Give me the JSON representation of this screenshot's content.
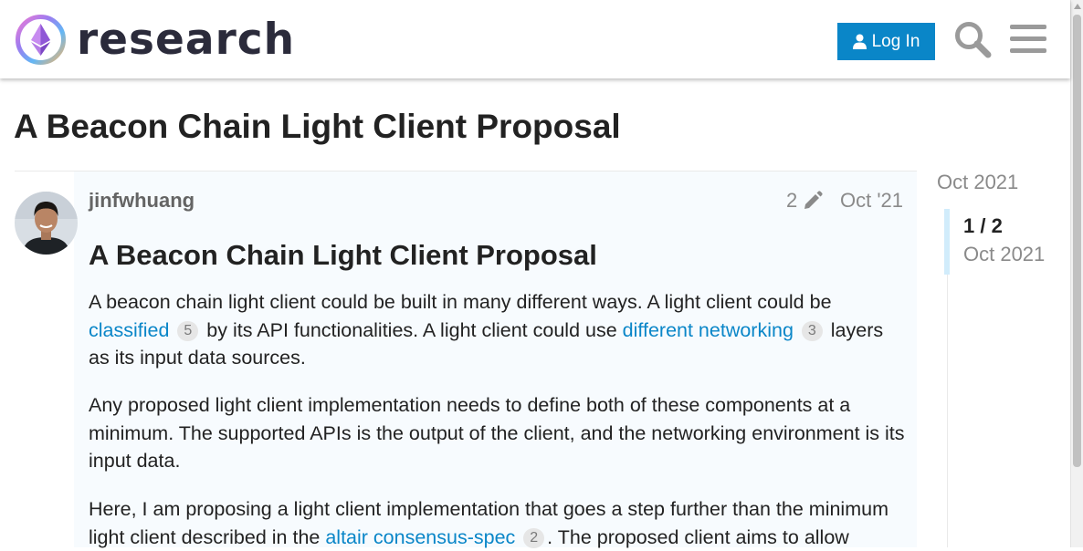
{
  "header": {
    "site_name": "research",
    "login_label": "Log In"
  },
  "colors": {
    "accent": "#0a86c8",
    "badge_bg": "#e6e6e6",
    "post_bg": "#f7fbfe",
    "timeline_handle": "#d1ecfb"
  },
  "icons": {
    "logo": "ethereum-research-logo",
    "login": "user-icon",
    "search": "search-icon",
    "menu": "hamburger-menu-icon",
    "edit": "pencil-icon"
  },
  "topic": {
    "title": "A Beacon Chain Light Client Proposal"
  },
  "post": {
    "username": "jinfwhuang",
    "edit_count": "2",
    "date": "Oct '21",
    "heading": "A Beacon Chain Light Client Proposal",
    "p1": {
      "t1": "A beacon chain light client could be built in many different ways. A light client could be ",
      "link1": "classified",
      "badge1": "5",
      "t2": " by its API functionalities. A light client could use ",
      "link2": "different networking",
      "badge2": "3",
      "t3": " layers as its input data sources."
    },
    "p2": "Any proposed light client implementation needs to define both of these components at a minimum. The supported APIs is the output of the client, and the networking environment is its input data.",
    "p3": {
      "t1": "Here, I am proposing a light client implementation that goes a step further than the minimum light client described in the ",
      "link1": "altair consensus-spec",
      "badge1": "2",
      "t2": ". The proposed client aims to allow"
    }
  },
  "timeline": {
    "start_date": "Oct 2021",
    "position": "1 / 2",
    "current_date": "Oct 2021"
  }
}
